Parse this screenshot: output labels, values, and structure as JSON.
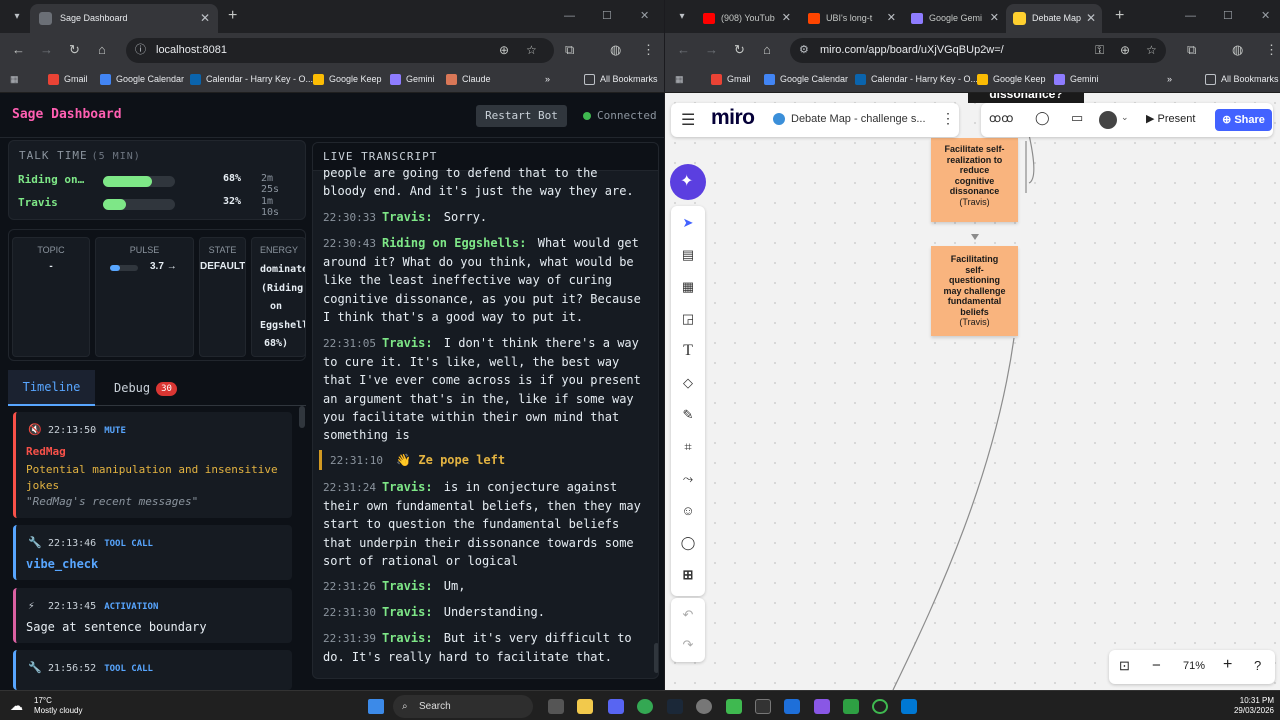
{
  "left_browser": {
    "tab_title": "Sage Dashboard",
    "url": "localhost:8081",
    "bookmarks": [
      "Gmail",
      "Google Calendar",
      "Calendar - Harry Key - O...",
      "Google Keep",
      "Gemini",
      "Claude"
    ],
    "all_bookmarks": "All Bookmarks"
  },
  "right_browser": {
    "tabs": [
      "(908) YouTub",
      "UBI's long-t",
      "Google Gemi",
      "Debate Map"
    ],
    "url": "miro.com/app/board/uXjVGqBUp2w=/",
    "bookmarks": [
      "Gmail",
      "Google Calendar",
      "Calendar - Harry Key - O...",
      "Google Keep",
      "Gemini"
    ],
    "all_bookmarks": "All Bookmarks"
  },
  "dashboard": {
    "title": "Sage Dashboard",
    "restart_label": "Restart Bot",
    "status": "Connected",
    "status_color": "#3fb950",
    "talk_time": {
      "title": "TALK TIME",
      "window": "(5 MIN)",
      "speakers": [
        {
          "name": "Riding on…",
          "percent_text": "68%",
          "time": "2m 25s",
          "fraction": 0.68
        },
        {
          "name": "Travis",
          "percent_text": "32%",
          "time": "1m 10s",
          "fraction": 0.32
        }
      ]
    },
    "stats": {
      "topic": {
        "label": "TOPIC",
        "value": "-"
      },
      "pulse": {
        "label": "PULSE",
        "value": "3.7",
        "trend": "→",
        "fraction": 0.37
      },
      "state": {
        "label": "STATE",
        "value": "DEFAULT"
      },
      "energy": {
        "label": "ENERGY",
        "lines": [
          "dominated",
          "(Riding",
          "on",
          "Eggshells",
          "68%)"
        ]
      }
    },
    "tabs": {
      "timeline": "Timeline",
      "debug": "Debug",
      "debug_count": "30"
    },
    "events": [
      {
        "icon": "🔇",
        "time": "22:13:50",
        "kind": "MUTE",
        "name": "RedMag",
        "text": "Potential manipulation and insensitive jokes",
        "quote": "\"RedMag's recent messages\"",
        "color": "#f85149"
      },
      {
        "icon": "🔧",
        "time": "22:13:46",
        "kind": "TOOL CALL",
        "text": "vibe_check",
        "color": "#58a6ff"
      },
      {
        "icon": "⚡",
        "time": "22:13:45",
        "kind": "ACTIVATION",
        "text": "Sage at sentence boundary",
        "color": "#db61a2"
      },
      {
        "icon": "🔧",
        "time": "21:56:52",
        "kind": "TOOL CALL",
        "color": "#58a6ff"
      }
    ],
    "transcript": {
      "title": "LIVE TRANSCRIPT",
      "partial_top": [
        "people are going to defend that to the",
        "bloody end. And it's just the way they are."
      ],
      "messages": [
        {
          "time": "22:30:33",
          "speaker": "Travis:",
          "text": "Sorry."
        },
        {
          "time": "22:30:43",
          "speaker": "Riding on Eggshells:",
          "text": "What would get around it? What do you think, what would be like the least ineffective way of curing cognitive dissonance, as you put it? Because I think that's a good way to put it."
        },
        {
          "time": "22:31:05",
          "speaker": "Travis:",
          "text": "I don't think there's a way to cure it. It's like, well, the best way that I've ever come across is if you present an argument that's in the, like if some way you facilitate within their own mind that something is"
        },
        {
          "time": "22:31:24",
          "speaker": "Travis:",
          "text": "is in conjecture against their own fundamental beliefs, then they may start to question the fundamental beliefs that underpin their dissonance towards some sort of rational or logical"
        },
        {
          "time": "22:31:26",
          "speaker": "Travis:",
          "text": "Um,"
        },
        {
          "time": "22:31:30",
          "speaker": "Travis:",
          "text": "Understanding."
        },
        {
          "time": "22:31:39",
          "speaker": "Travis:",
          "text": "But it's very difficult to do. It's really hard to facilitate that."
        }
      ],
      "system": {
        "time": "22:31:10",
        "icon": "👋",
        "text": "Ze pope left"
      }
    }
  },
  "miro": {
    "logo": "miro",
    "board_name": "Debate Map - challenge s...",
    "present_label": "Present",
    "share_label": "Share",
    "top_note": "dissonance?",
    "stickies": [
      {
        "lines": [
          "Facilitate self-",
          "realization to",
          "reduce",
          "cognitive",
          "dissonance"
        ],
        "author": "(Travis)"
      },
      {
        "lines": [
          "Facilitating",
          "self-",
          "questioning",
          "may challenge",
          "fundamental",
          "beliefs"
        ],
        "author": "(Travis)"
      }
    ],
    "zoom": "71%"
  },
  "taskbar": {
    "weather_temp": "17°C",
    "weather_desc": "Mostly cloudy",
    "search": "Search",
    "time": "10:31 PM",
    "date": "29/03/2026"
  }
}
